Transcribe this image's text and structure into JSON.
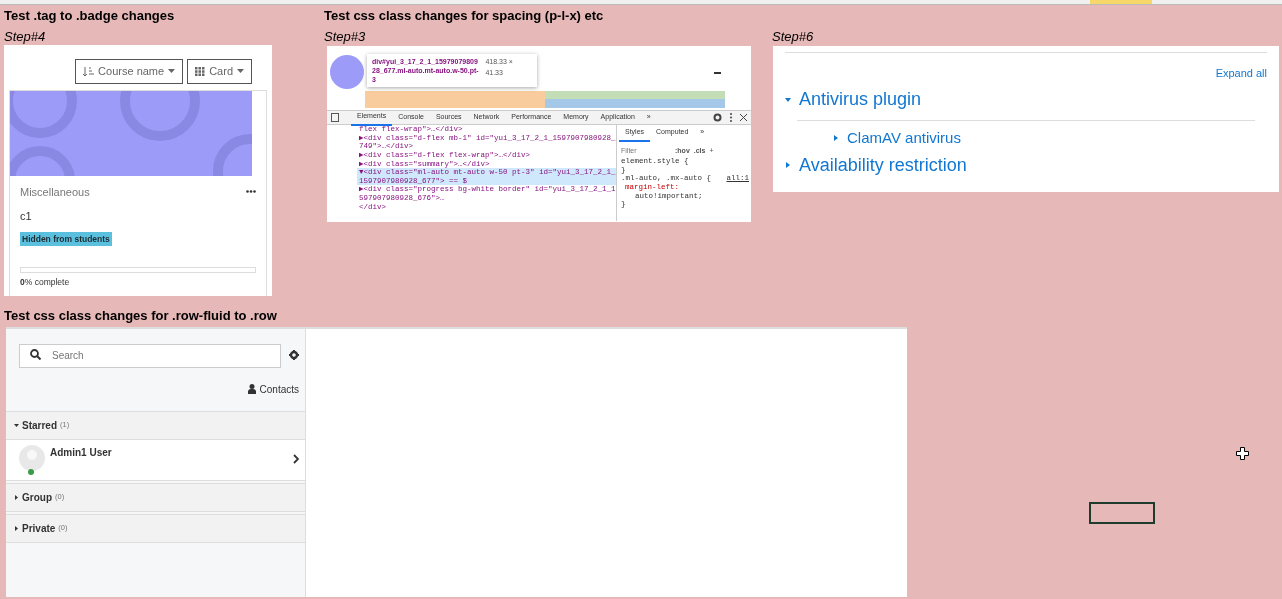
{
  "course_panel": {
    "heading": "Test .tag to .badge changes",
    "step": "Step#4",
    "sort_button": "Course name",
    "view_button": "Card",
    "course": {
      "category": "Miscellaneous",
      "name": "c1",
      "badge": "Hidden from students",
      "progress": {
        "level": 0,
        "text": "**0**% complete"
      }
    }
  },
  "devtools_panel": {
    "heading": "Test css class changes for spacing (p-l-x) etc",
    "step": "Step#3",
    "tooltip": {
      "selector": "div#yui_3_17_2_1_1597907980928_677.ml-auto.mt-auto.w-50.pt-3",
      "size": "418.33 × 41.33"
    },
    "tabs": [
      {
        "label": "Elements",
        "selected": true
      },
      {
        "label": "Console",
        "selected": false
      },
      {
        "label": "Sources",
        "selected": false
      },
      {
        "label": "Network",
        "selected": false
      },
      {
        "label": "Performance",
        "selected": false
      },
      {
        "label": "Memory",
        "selected": false
      },
      {
        "label": "Application",
        "selected": false
      },
      {
        "label": "»",
        "selected": false
      }
    ],
    "dom_lines": [
      {
        "text": "flex flex-wrap\">…</div>",
        "selected": false
      },
      {
        "text": "▶<div class=\"d-flex mb-1\" id=\"yui_3_17_2_1_1597907980928_749\">…</div>",
        "selected": false
      },
      {
        "text": "▶<div class=\"d-flex flex-wrap\">…</div>",
        "selected": false
      },
      {
        "text": "▶<div class=\"summary\">…</div>",
        "selected": false
      },
      {
        "text": "▼<div class=\"ml-auto mt-auto w-50 pt-3\" id=\"yui_3_17_2_1_1597907980928_677\"> == $",
        "selected": true
      },
      {
        "text": "▶<div class=\"progress bg-white border\" id=\"yui_3_17_2_1_1597907980928_676\">…",
        "selected": false
      },
      {
        "text": "</div>",
        "selected": false
      }
    ],
    "style_tabs": [
      {
        "label": "Styles",
        "selected": true
      },
      {
        "label": "Computed",
        "selected": false
      },
      {
        "label": "»",
        "selected": false
      }
    ],
    "filter_placeholder": "Filter",
    "hov": ":hov",
    "cls": ".cls",
    "add": "+",
    "style_lines": [
      "element.style {",
      "}",
      ".ml-auto, .mx-auto {",
      "margin-left:",
      "auto!important;",
      "}"
    ],
    "style_source": "all:1"
  },
  "settings_panel": {
    "step": "Step#6",
    "expand_all": "Expand all",
    "tree": [
      {
        "label": "Antivirus plugin",
        "expanded": true,
        "children": [
          {
            "label": "ClamAV antivirus",
            "expanded": false
          }
        ]
      },
      {
        "label": "Availability restriction",
        "expanded": false
      }
    ]
  },
  "messaging_panel": {
    "heading": "Test css class changes for .row-fluid to .row",
    "search_placeholder": "Search",
    "contacts": "Contacts",
    "sections": [
      {
        "label": "Starred",
        "count": "(1)",
        "expanded": true,
        "contacts": [
          {
            "name": "Admin1 User",
            "online": true
          }
        ]
      },
      {
        "label": "Group",
        "count": "(0)",
        "expanded": false
      },
      {
        "label": "Private",
        "count": "(0)",
        "expanded": false
      }
    ]
  }
}
